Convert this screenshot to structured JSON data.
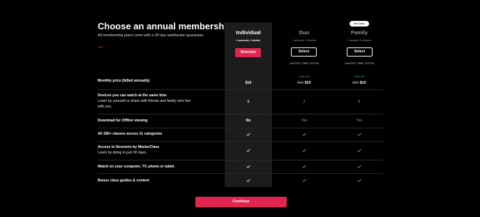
{
  "header": {
    "title": "Choose an annual membership",
    "subtitle": "All membership plans come with a 30-day satisfaction guarantee."
  },
  "colors": {
    "accent": "#e2254f",
    "discount": "#3fbf5f",
    "background": "#000000",
    "highlight": "#1c1c1e"
  },
  "plans": [
    {
      "name": "Individual",
      "devices": "1 account, 1 device",
      "button": "Selected",
      "selected": true
    },
    {
      "name": "Duo",
      "devices": "1 account, 2 devices",
      "button": "Select",
      "selected": false,
      "offer": "LIMITED TIME OFFER"
    },
    {
      "name": "Family",
      "devices": "1 account, 6 devices",
      "button": "Select",
      "selected": false,
      "offer": "LIMITED TIME OFFER",
      "badge": "Best Value"
    }
  ],
  "rows": {
    "price": {
      "label": "Monthly price (billed annually)",
      "individual": "$10",
      "duo": {
        "discount": "33% Off",
        "original": "$15",
        "now": "$10"
      },
      "family": {
        "discount": "50% Off",
        "original": "$20",
        "now": "$10"
      }
    },
    "devices": {
      "label": "Devices you can watch at the same time",
      "sub": "Learn by yourself or share with friends and family who live with you.",
      "values": [
        "1",
        "2",
        "6"
      ]
    },
    "offline": {
      "label": "Download for Offline viewing",
      "values": [
        "No",
        "Yes",
        "Yes"
      ]
    },
    "classes": {
      "label": "All 180+ classes across 11 categories",
      "icon": "check-icon"
    },
    "sessions": {
      "label": "Access to Sessions by MasterClass",
      "sub": "Learn by doing in just 30 days.",
      "icon": "check-icon"
    },
    "watch": {
      "label": "Watch on your computer, TV, phone or tablet",
      "icon": "check-icon"
    },
    "bonus": {
      "label": "Bonus class guides & content",
      "icon": "check-icon"
    }
  },
  "footer": {
    "continue_label": "Continue"
  }
}
